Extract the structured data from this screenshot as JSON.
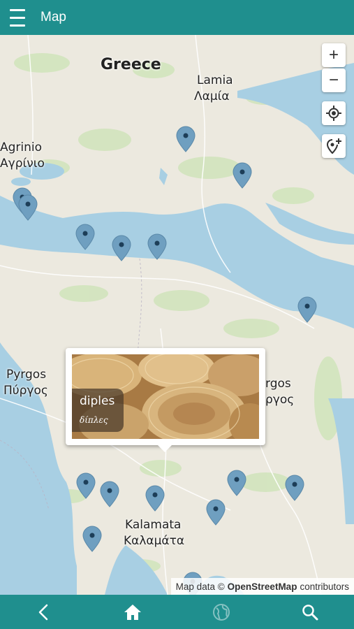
{
  "header": {
    "title": "Map",
    "menu_icon": "hamburger-menu-icon"
  },
  "map": {
    "labels": {
      "country": "Greece",
      "lamia_en": "Lamia",
      "lamia_gr": "Λαμία",
      "agrinio_en": "Agrinio",
      "agrinio_gr": "Αγρίνιο",
      "pyrgos_en": "Pyrgos",
      "pyrgos_gr": "Πύργος",
      "tripoli_en": "rgos",
      "tripoli_gr": "ργος",
      "kalamata_en": "Kalamata",
      "kalamata_gr": "Καλαμάτα"
    },
    "controls": {
      "zoom_in": "+",
      "zoom_out": "−"
    },
    "pin_color": "#6f9fc0",
    "water_color": "#a8cfe3",
    "land_color": "#ece9df"
  },
  "popup": {
    "name_en": "diples",
    "name_gr": "δίπλες"
  },
  "attribution": {
    "prefix": "Map data ©",
    "source": "OpenStreetMap",
    "suffix": "contributors"
  },
  "bottom_nav": {
    "items": [
      "back-icon",
      "home-icon",
      "globe-icon",
      "search-icon"
    ]
  }
}
